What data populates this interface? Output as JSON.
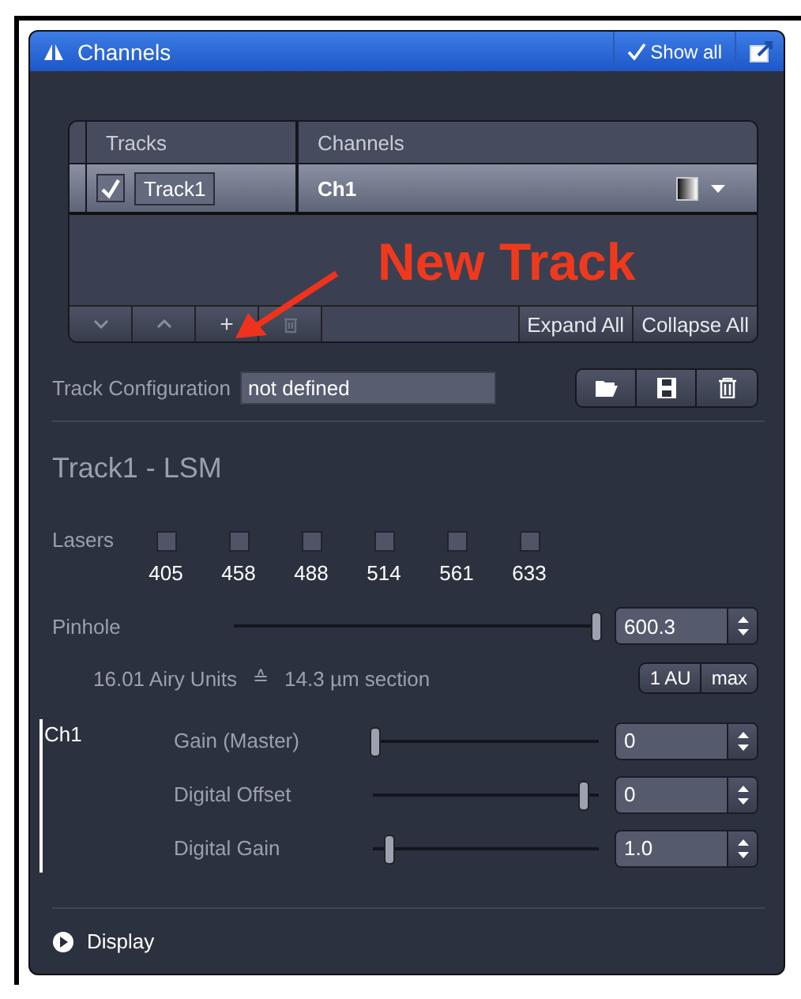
{
  "window": {
    "title": "Channels",
    "show_all": {
      "label": "Show all",
      "checked": true
    }
  },
  "tracks_table": {
    "columns": [
      "Tracks",
      "Channels"
    ],
    "rows": [
      {
        "checked": true,
        "track": "Track1",
        "channels": "Ch1"
      }
    ],
    "add_label": "+",
    "buttons": [
      "Expand All",
      "Collapse All"
    ]
  },
  "annotation": "New Track",
  "track_configuration": {
    "label": "Track Configuration",
    "value": "not defined"
  },
  "section_title": "Track1 - LSM",
  "lasers": {
    "label": "Lasers",
    "items": [
      {
        "wavelength": "405",
        "checked": false
      },
      {
        "wavelength": "458",
        "checked": false
      },
      {
        "wavelength": "488",
        "checked": false
      },
      {
        "wavelength": "514",
        "checked": false
      },
      {
        "wavelength": "561",
        "checked": false
      },
      {
        "wavelength": "633",
        "checked": false
      }
    ]
  },
  "pinhole": {
    "label": "Pinhole",
    "level": 0.99,
    "value": "600.3",
    "airy": "16.01 Airy Units",
    "equals": "≙",
    "section": "14.3 µm section",
    "buttons": [
      "1 AU",
      "max"
    ]
  },
  "channel": {
    "label": "Ch1",
    "controls": [
      {
        "label": "Gain (Master)",
        "level": 0.01,
        "value": "0"
      },
      {
        "label": "Digital Offset",
        "level": 0.93,
        "value": "0"
      },
      {
        "label": "Digital Gain",
        "level": 0.07,
        "value": "1.0"
      }
    ]
  },
  "display": {
    "label": "Display",
    "expanded": false
  }
}
